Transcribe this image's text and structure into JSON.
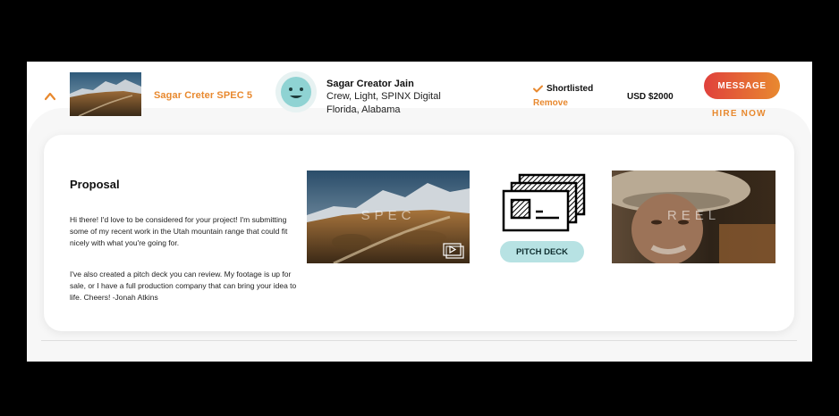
{
  "listing": {
    "spec_title": "Sagar Creter SPEC 5",
    "thumbnail_icon": "mountain-thumbnail"
  },
  "creator": {
    "name": "Sagar Creator Jain",
    "roles": "Crew, Light, SPINX Digital",
    "location": "Florida, Alabama",
    "avatar_icon": "smiley-avatar-icon"
  },
  "status": {
    "shortlisted_label": "Shortlisted",
    "remove_label": "Remove"
  },
  "price": "USD $2000",
  "actions": {
    "message_label": "MESSAGE",
    "hire_label": "HIRE NOW"
  },
  "proposal": {
    "heading": "Proposal",
    "paragraph1": "Hi there!  I'd love to be considered for your project!  I'm submitting some of my recent work in the Utah mountain range that could fit nicely with what you're going for.",
    "paragraph2": "I've also created a pitch deck you can review.  My footage is up for sale, or I have a full production company that can bring your idea to life.  Cheers! -Jonah Atkins"
  },
  "media": {
    "spec_label": "SPEC",
    "reel_label": "REEL",
    "pitch_deck_label": "PITCH DECK"
  },
  "colors": {
    "accent_orange": "#e8892f",
    "accent_red": "#e0413c",
    "pitch_deck_teal": "#b7e2e3",
    "avatar_bg": "#e7f2f2"
  }
}
